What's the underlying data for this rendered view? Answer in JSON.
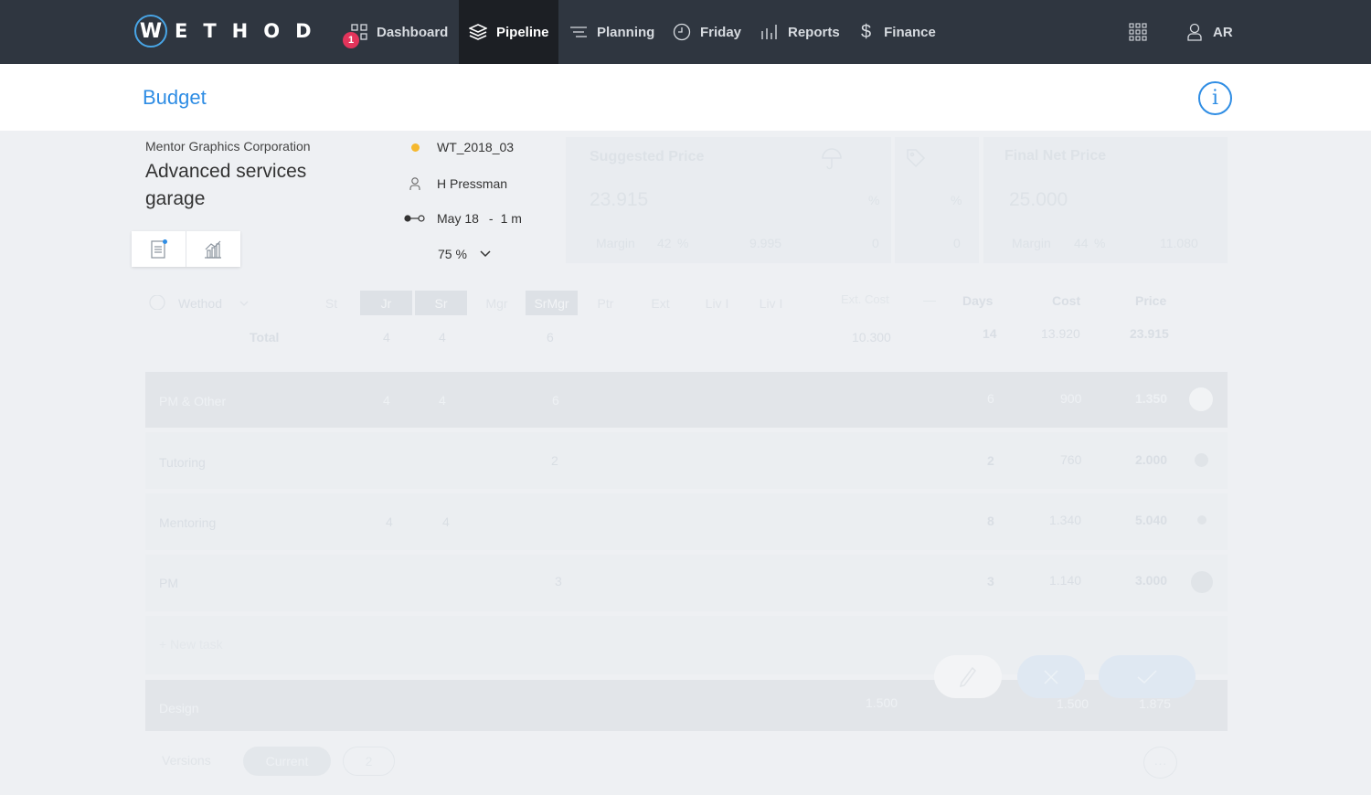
{
  "nav": {
    "logo_letter": "W",
    "logo_rest": "ETHOD",
    "notification_count": "1",
    "items": [
      {
        "label": "Dashboard",
        "icon": "grid-icon"
      },
      {
        "label": "Pipeline",
        "icon": "layers-icon",
        "active": true
      },
      {
        "label": "Planning",
        "icon": "lines-icon"
      },
      {
        "label": "Friday",
        "icon": "clock-icon"
      },
      {
        "label": "Reports",
        "icon": "bar-chart-icon"
      },
      {
        "label": "Finance",
        "icon": "dollar-icon"
      }
    ],
    "apps_icon": "apps-grid-icon",
    "user_initials": "AR"
  },
  "header": {
    "title": "Budget",
    "info_label": "i"
  },
  "project": {
    "client": "Mentor Graphics Corporation",
    "name": "Advanced services garage",
    "code": "WT_2018_03",
    "manager": "H Pressman",
    "start": "May 18",
    "duration": "1 m",
    "probability": "75 %"
  },
  "pricing": {
    "suggested": {
      "label": "Suggested Price",
      "value": "23.915",
      "pct": "%",
      "margin_label": "Margin",
      "margin_pct": "42",
      "margin_pct_sign": "%",
      "margin_value": "9.995",
      "zero": "0"
    },
    "discount": {
      "pct": "%",
      "zero": "0"
    },
    "final": {
      "label": "Final Net Price",
      "value": "25.000",
      "margin_label": "Margin",
      "margin_pct": "44",
      "margin_pct_sign": "%",
      "margin_value": "11.080"
    }
  },
  "table": {
    "company_select": "Wethod",
    "levels": [
      "St",
      "Jr",
      "Sr",
      "Mgr",
      "SrMgr",
      "Ptr",
      "Ext",
      "Liv I",
      "Liv I"
    ],
    "ext_cost_label": "Ext. Cost",
    "ext_cost_dash": "—",
    "headers": {
      "days": "Days",
      "cost": "Cost",
      "price": "Price"
    },
    "total": {
      "label": "Total",
      "jr": "4",
      "sr": "4",
      "srmgr": "6",
      "ext": "10.300",
      "days": "14",
      "cost": "13.920",
      "price": "23.915"
    },
    "rows": [
      {
        "label": "PM & Other",
        "jr": "4",
        "sr": "4",
        "srmgr": "6",
        "days": "6",
        "cost": "900",
        "price": "1.350"
      },
      {
        "label": "Tutoring",
        "srmgr": "2",
        "days": "2",
        "cost": "760",
        "price": "2.000"
      },
      {
        "label": "Mentoring",
        "jr": "4",
        "sr": "4",
        "days": "8",
        "cost": "1.340",
        "price": "5.040"
      },
      {
        "label": "PM",
        "srmgr": "3",
        "days": "3",
        "cost": "1.140",
        "price": "3.000"
      }
    ],
    "new_task": "+ New task",
    "design": {
      "label": "Design",
      "ext": "1.500",
      "cost": "1.500",
      "price": "1.875"
    }
  },
  "versions": {
    "label": "Versions",
    "current": "Current",
    "v2": "2",
    "more": "···"
  }
}
